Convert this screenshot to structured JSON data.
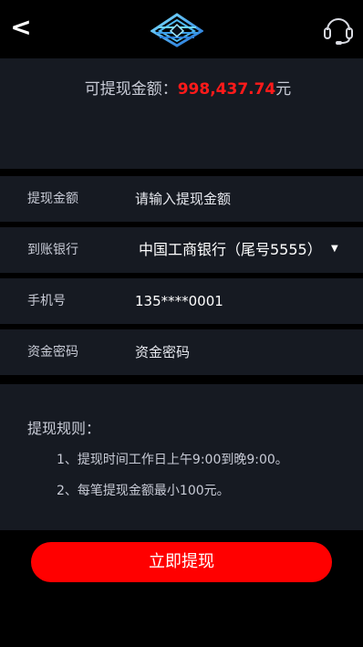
{
  "header": {
    "back_label": "<",
    "logo_icon": "bank-logo-icon",
    "support_icon": "headset-icon"
  },
  "balance": {
    "label": "可提现金额：",
    "amount": "998,437.74",
    "unit": "元",
    "amount_color": "#ff1a1a"
  },
  "form": {
    "amount": {
      "label": "提现金额",
      "placeholder": "请输入提现金额",
      "value": ""
    },
    "bank": {
      "label": "到账银行",
      "selected": "中国工商银行（尾号5555）"
    },
    "phone": {
      "label": "手机号",
      "value": "135****0001"
    },
    "password": {
      "label": "资金密码",
      "placeholder": "资金密码",
      "value": ""
    }
  },
  "rules": {
    "title": "提现规则：",
    "items": [
      "1、提现时间工作日上午9:00到晚9:00。",
      "2、每笔提现金额最小100元。"
    ]
  },
  "submit": {
    "label": "立即提现",
    "color": "#ff0000"
  }
}
